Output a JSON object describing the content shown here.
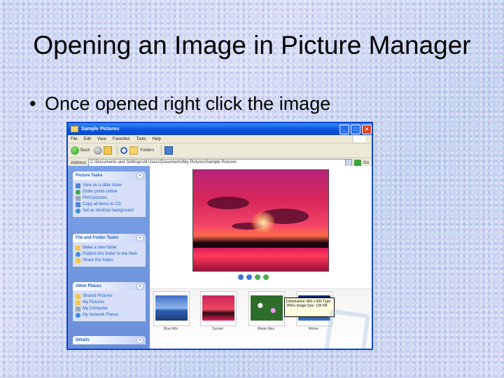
{
  "slide": {
    "title": "Opening an Image in Picture Manager",
    "bullet": "Once opened  right click the image"
  },
  "window": {
    "title": "Sample Pictures",
    "menu": [
      "File",
      "Edit",
      "View",
      "Favorites",
      "Tools",
      "Help"
    ],
    "toolbar": {
      "back": "Back",
      "folders": "Folders"
    },
    "address_label": "Address",
    "address_value": "C:\\Documents and Settings\\All Users\\Documents\\My Pictures\\Sample Pictures",
    "go_label": "Go",
    "picture_tasks": {
      "title": "Picture Tasks",
      "items": [
        "View as a slide show",
        "Order prints online",
        "Print pictures",
        "Copy all items to CD",
        "Set as desktop background"
      ]
    },
    "file_folder_tasks": {
      "title": "File and Folder Tasks",
      "items": [
        "Make a new folder",
        "Publish this folder to the Web",
        "Share this folder"
      ]
    },
    "other_places": {
      "title": "Other Places",
      "items": [
        "Shared Pictures",
        "My Pictures",
        "My Computer",
        "My Network Places"
      ]
    },
    "details": {
      "title": "Details"
    },
    "thumbnails": [
      "Blue hills",
      "Sunset",
      "Water lilies",
      "Winter"
    ],
    "tooltip": "Dimensions: 800 x 600 Type: JPEG Image Size: 105 KB"
  },
  "colors": {
    "titlebar": "#0b56e0",
    "taskpane": "#6a8fd8",
    "link": "#215dc6"
  }
}
